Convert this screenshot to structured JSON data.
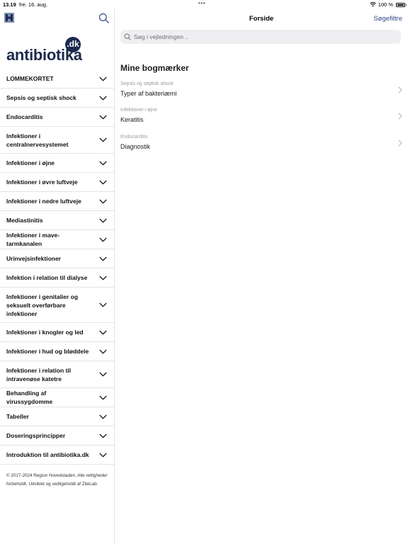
{
  "status": {
    "time": "13.19",
    "date": "fre. 16. aug.",
    "dots": "•••",
    "battery": "100 %"
  },
  "brand": {
    "dk": ".dk",
    "name": "antibiotika",
    "color": "#1c2a4e"
  },
  "sidebar": {
    "items": [
      {
        "label": "LOMMEKORTET",
        "h": 1
      },
      {
        "label": "Sepsis og septisk shock",
        "h": 1
      },
      {
        "label": "Endocarditis",
        "h": 1
      },
      {
        "label": "Infektioner i centralnervesystemet",
        "h": 2
      },
      {
        "label": "Infektioner i øjne",
        "h": 1
      },
      {
        "label": "Infektioner i øvre luftveje",
        "h": 1
      },
      {
        "label": "Infektioner i nedre luftveje",
        "h": 1
      },
      {
        "label": "Mediastinitis",
        "h": 1
      },
      {
        "label": "Infektioner i mave-tarmkanalen",
        "h": 1
      },
      {
        "label": "Urinvejsinfektioner",
        "h": 1
      },
      {
        "label": "Infektion i relation til dialyse",
        "h": 1
      },
      {
        "label": "Infektioner i genitalier og seksuelt overførbare infektioner",
        "h": 3
      },
      {
        "label": "Infektioner i knogler og led",
        "h": 1
      },
      {
        "label": "Infektioner i hud og bløddele",
        "h": 1
      },
      {
        "label": "Infektioner i relation til intravenøse katetre",
        "h": 2
      },
      {
        "label": "Behandling af virussygdomme",
        "h": 1
      },
      {
        "label": "Tabeller",
        "h": 1
      },
      {
        "label": "Doseringsprincipper",
        "h": 1
      },
      {
        "label": "Introduktion til antibiotika.dk",
        "h": 1
      }
    ],
    "copyright": "© 2017-2024 Region Hovedstaden. Alle rettigheder forbeholdt. Udviklet og vedligeholdt af ZiteLab."
  },
  "main": {
    "title": "Forside",
    "filter_label": "Søgefiltre",
    "search_placeholder": "Søg i vejledningen ..",
    "bookmarks_title": "Mine bogmærker",
    "bookmarks": [
      {
        "category": "Sepsis og septisk shock",
        "title": "Typer af bakteriæmi"
      },
      {
        "category": "Infektioner i øjne",
        "title": "Keratitis"
      },
      {
        "category": "Endocarditis",
        "title": "Diagnostik"
      }
    ]
  },
  "colors": {
    "accent": "#2e4a86",
    "divider": "#e4e4e8"
  }
}
